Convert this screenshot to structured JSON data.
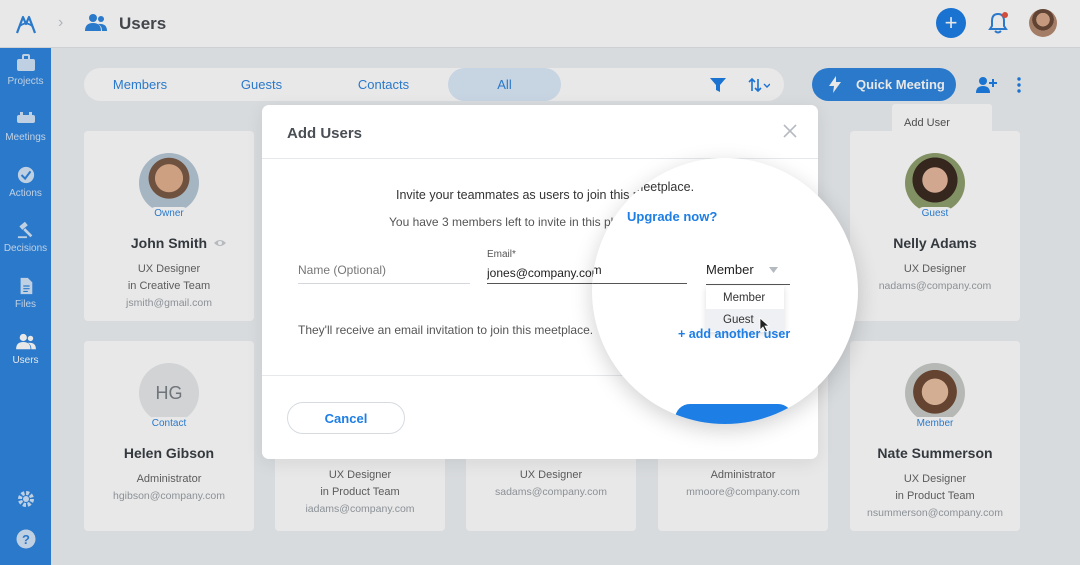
{
  "header": {
    "page_title": "Users"
  },
  "sidebar": {
    "items": [
      {
        "label": "Projects",
        "icon": "briefcase-icon"
      },
      {
        "label": "Meetings",
        "icon": "meeting-icon"
      },
      {
        "label": "Actions",
        "icon": "check-circle-icon"
      },
      {
        "label": "Decisions",
        "icon": "gavel-icon"
      },
      {
        "label": "Files",
        "icon": "file-icon"
      },
      {
        "label": "Users",
        "icon": "users-icon",
        "active": true
      }
    ]
  },
  "toolbar": {
    "tabs": [
      "Members",
      "Guests",
      "Contacts",
      "All"
    ],
    "active_tab": "All",
    "quick_meeting": "Quick Meeting",
    "tooltip": "Add User"
  },
  "cards": [
    {
      "initials": "",
      "badge": "Owner",
      "name": "John Smith",
      "role": "UX Designer",
      "team": "in Creative Team",
      "email": "jsmith@gmail.com"
    },
    {
      "initials": "",
      "badge": "Guest",
      "name": "Nelly Adams",
      "role": "UX Designer",
      "team": "",
      "email": "nadams@company.com"
    },
    {
      "initials": "HG",
      "badge": "Contact",
      "name": "Helen Gibson",
      "role": "Administrator",
      "team": "",
      "email": "hgibson@company.com"
    },
    {
      "initials": "",
      "badge": "",
      "name": "",
      "role": "UX Designer",
      "team": "in Product Team",
      "email": "iadams@company.com"
    },
    {
      "initials": "",
      "badge": "",
      "name": "",
      "role": "UX Designer",
      "team": "",
      "email": "sadams@company.com"
    },
    {
      "initials": "",
      "badge": "",
      "name": "",
      "role": "Administrator",
      "team": "",
      "email": "mmoore@company.com"
    },
    {
      "initials": "",
      "badge": "Member",
      "name": "Nate Summerson",
      "role": "UX Designer",
      "team": "in Product Team",
      "email": "nsummerson@company.com"
    }
  ],
  "modal": {
    "title": "Add Users",
    "invite_text": "Invite your teammates as users to join this meetplace.",
    "members_left": "You have 3 members left to invite in this plan.",
    "upgrade_link": "Upgrade now?",
    "name_placeholder": "Name (Optional)",
    "email_label": "Email*",
    "email_value": "jones@company.com",
    "role_selected": "Member",
    "role_options": [
      "Member",
      "Guest"
    ],
    "hovered_option": "Guest",
    "invite_note": "They'll receive an email invitation to join this meetplace.",
    "add_another": "+ add another user",
    "cancel_label": "Cancel"
  },
  "colors": {
    "primary": "#1d7ee6",
    "sidebar": "#2f86e0",
    "notification_dot": "#e8533f"
  }
}
